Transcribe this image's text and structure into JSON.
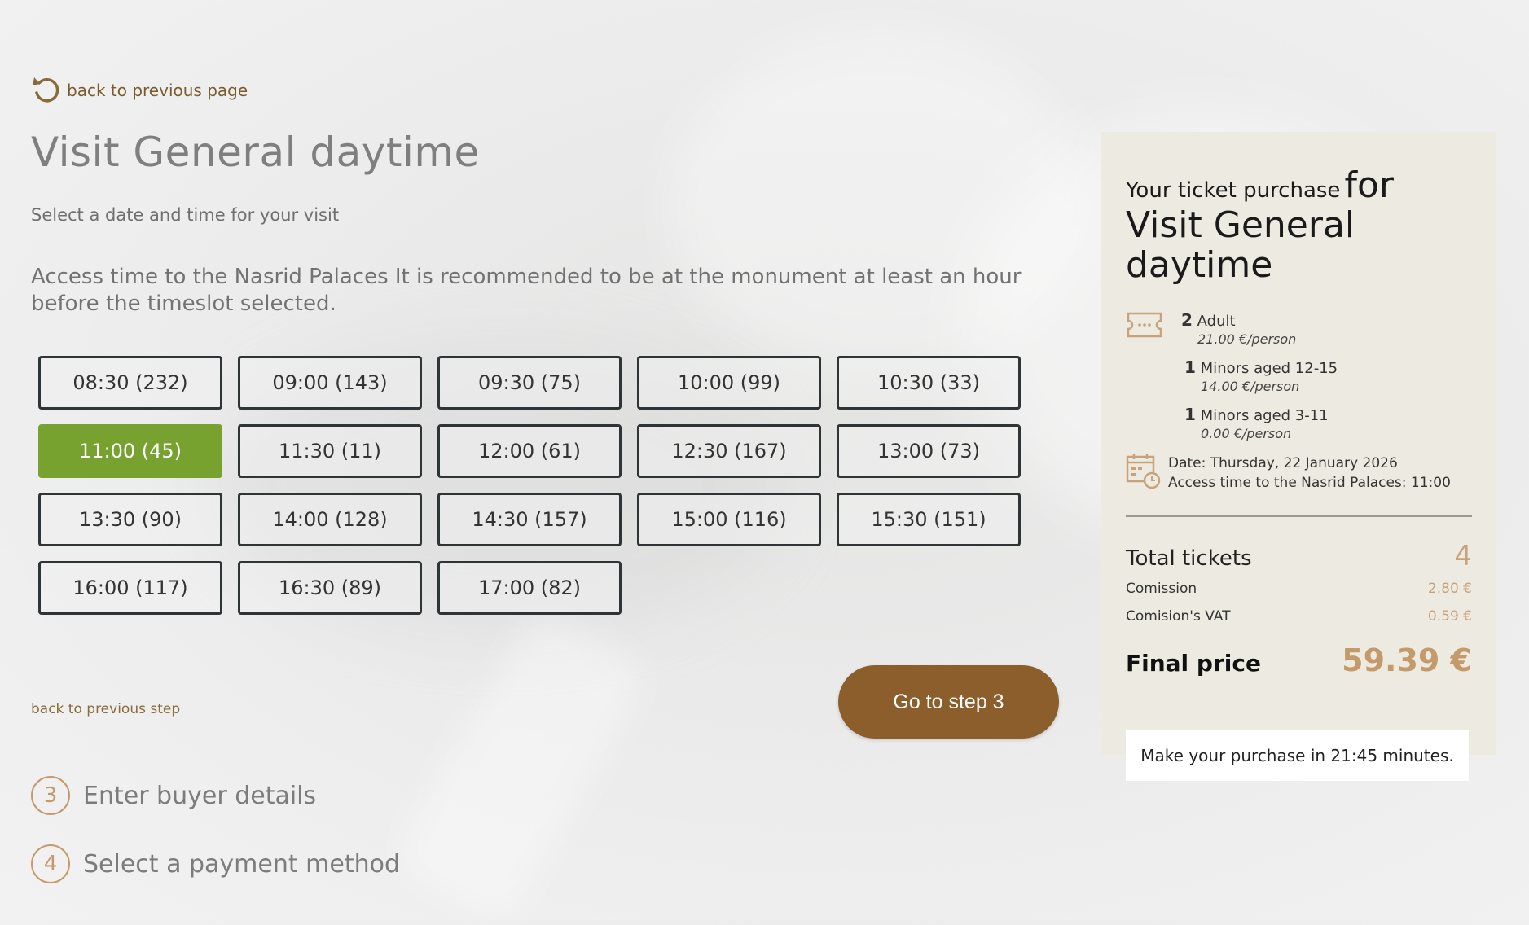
{
  "nav": {
    "back_page_label": "back to previous page",
    "back_step_label": "back to previous step"
  },
  "main": {
    "title": "Visit General daytime",
    "subtitle": "Select a date and time for your visit",
    "notice": "Access time to the Nasrid Palaces It is recommended to be at the monument at least an hour before the timeslot selected.",
    "timeslots": [
      "08:30 (232)",
      "09:00 (143)",
      "09:30 (75)",
      "10:00 (99)",
      "10:30 (33)",
      "11:00 (45)",
      "11:30 (11)",
      "12:00 (61)",
      "12:30 (167)",
      "13:00 (73)",
      "13:30 (90)",
      "14:00 (128)",
      "14:30 (157)",
      "15:00 (116)",
      "15:30 (151)",
      "16:00 (117)",
      "16:30 (89)",
      "17:00 (82)"
    ],
    "selected_slot": "11:00 (45)",
    "next_button": "Go to step 3"
  },
  "steps": [
    {
      "number": "3",
      "label": "Enter buyer details"
    },
    {
      "number": "4",
      "label": "Select a payment method"
    }
  ],
  "summary": {
    "title_small": "Your ticket purchase",
    "title_big": "for Visit General daytime",
    "tickets": [
      {
        "qty": "2",
        "type": "Adult",
        "price": "21.00 €/person"
      },
      {
        "qty": "1",
        "type": "Minors aged 12-15",
        "price": "14.00 €/person"
      },
      {
        "qty": "1",
        "type": "Minors aged 3-11",
        "price": "0.00 €/person"
      }
    ],
    "date_line": "Date: Thursday, 22 January 2026",
    "access_line": "Access time to the Nasrid Palaces: 11:00",
    "total_tickets_label": "Total tickets",
    "total_tickets_value": "4",
    "commission_label": "Comission",
    "commission_value": "2.80 €",
    "vat_label": "Comision's VAT",
    "vat_value": "0.59 €",
    "final_label": "Final price",
    "final_value": "59.39 €",
    "timer_text": "Make your purchase in 21:45 minutes."
  },
  "colors": {
    "accent_brown": "#8b5e2b",
    "selected_green": "#78a22f",
    "price_gold": "#c59a6a"
  }
}
